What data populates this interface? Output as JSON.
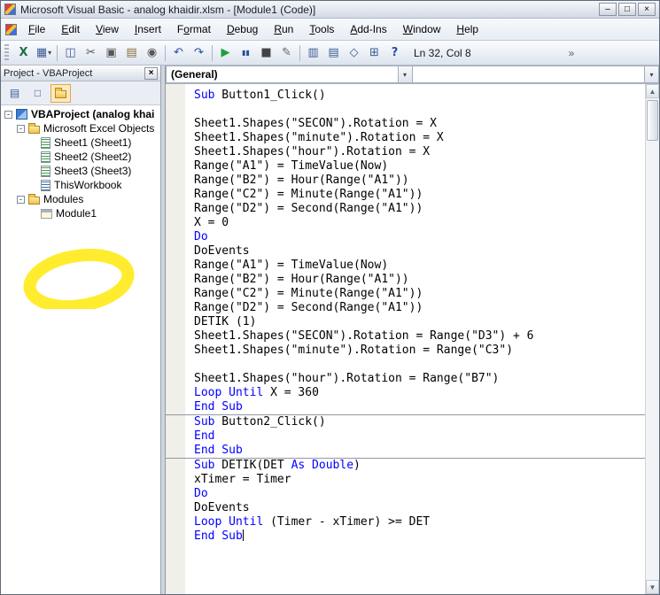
{
  "colors": {
    "keyword": "#0000ff",
    "code_text": "#000000",
    "marker": "#ffe800",
    "run_green": "#1e9e3e"
  },
  "window": {
    "title": "Microsoft Visual Basic - analog khaidir.xlsm - [Module1 (Code)]",
    "controls": [
      {
        "name": "minimize-button",
        "glyph": "–"
      },
      {
        "name": "maximize-button",
        "glyph": "□"
      },
      {
        "name": "close-button",
        "glyph": "×"
      }
    ]
  },
  "menu_bar": {
    "items": [
      {
        "label": "File",
        "accel": 0
      },
      {
        "label": "Edit",
        "accel": 0
      },
      {
        "label": "View",
        "accel": 0
      },
      {
        "label": "Insert",
        "accel": 0
      },
      {
        "label": "Format",
        "accel": 1
      },
      {
        "label": "Debug",
        "accel": 0
      },
      {
        "label": "Run",
        "accel": 0
      },
      {
        "label": "Tools",
        "accel": 0
      },
      {
        "label": "Add-Ins",
        "accel": 0
      },
      {
        "label": "Window",
        "accel": 0
      },
      {
        "label": "Help",
        "accel": 0
      }
    ]
  },
  "toolbar": {
    "position_indicator": "Ln 32, Col 8",
    "overflow_glyph": "»",
    "buttons": [
      {
        "name": "view-microsoft-excel-button",
        "glyph": "X",
        "color": "#1d7044",
        "bold": true
      },
      {
        "name": "insert-userform-button",
        "glyph": "▦",
        "color": "#3c5a96",
        "dropdown": true
      },
      {
        "sep": true
      },
      {
        "name": "save-button",
        "glyph": "◫",
        "color": "#3c5a96"
      },
      {
        "name": "cut-button",
        "glyph": "✂",
        "color": "#555555"
      },
      {
        "name": "copy-button",
        "glyph": "▣",
        "color": "#555555"
      },
      {
        "name": "paste-button",
        "glyph": "▤",
        "color": "#8a6d3b"
      },
      {
        "name": "find-button",
        "glyph": "◉",
        "color": "#555555"
      },
      {
        "sep": true
      },
      {
        "name": "undo-button",
        "glyph": "↶",
        "color": "#2b4fa0"
      },
      {
        "name": "redo-button",
        "glyph": "↷",
        "color": "#2b4fa0"
      },
      {
        "sep": true
      },
      {
        "name": "run-button",
        "glyph": "▶",
        "color": "#1e9e3e"
      },
      {
        "name": "break-button",
        "glyph": "▮▮",
        "color": "#2b4fa0",
        "small": true
      },
      {
        "name": "reset-button",
        "glyph": "■",
        "color": "#444444"
      },
      {
        "name": "design-mode-button",
        "glyph": "✎",
        "color": "#666666"
      },
      {
        "sep": true
      },
      {
        "name": "project-explorer-button",
        "glyph": "▥",
        "color": "#3c5a96"
      },
      {
        "name": "properties-window-button",
        "glyph": "▤",
        "color": "#3c5a96"
      },
      {
        "name": "object-browser-button",
        "glyph": "◇",
        "color": "#3c5a96"
      },
      {
        "name": "toolbox-button",
        "glyph": "⊞",
        "color": "#3c5a96"
      },
      {
        "name": "help-button",
        "glyph": "?",
        "color": "#2b4fa0",
        "bold": true
      }
    ]
  },
  "project_panel": {
    "title": "Project - VBAProject",
    "close_glyph": "×",
    "buttons": [
      {
        "name": "view-code-button",
        "glyph": "▤"
      },
      {
        "name": "view-object-button",
        "glyph": "□"
      },
      {
        "name": "toggle-folders-button",
        "icon": "folder",
        "pressed": true
      }
    ],
    "tree": [
      {
        "id": "vbaproject",
        "label": "VBAProject (analog khai",
        "icon": "project",
        "depth": 0,
        "expander": "-",
        "bold": true
      },
      {
        "id": "excel-objects",
        "label": "Microsoft Excel Objects",
        "icon": "folder",
        "depth": 1,
        "expander": "-"
      },
      {
        "id": "sheet1",
        "label": "Sheet1 (Sheet1)",
        "icon": "sheet",
        "depth": 2
      },
      {
        "id": "sheet2",
        "label": "Sheet2 (Sheet2)",
        "icon": "sheet",
        "depth": 2
      },
      {
        "id": "sheet3",
        "label": "Sheet3 (Sheet3)",
        "icon": "sheet",
        "depth": 2
      },
      {
        "id": "thisworkbook",
        "label": "ThisWorkbook",
        "icon": "workbook",
        "depth": 2
      },
      {
        "id": "modules",
        "label": "Modules",
        "icon": "folder",
        "depth": 1,
        "expander": "-"
      },
      {
        "id": "module1",
        "label": "Module1",
        "icon": "module",
        "depth": 2,
        "highlighted": true
      }
    ]
  },
  "code_window": {
    "object_combo": "(General)",
    "procedure_combo": "",
    "lines": [
      {
        "s": [
          [
            "b",
            "Sub"
          ],
          [
            "k",
            " Button1_Click()"
          ]
        ]
      },
      {
        "s": []
      },
      {
        "s": [
          [
            "k",
            "Sheet1.Shapes(\"SECON\").Rotation = X"
          ]
        ]
      },
      {
        "s": [
          [
            "k",
            "Sheet1.Shapes(\"minute\").Rotation = X"
          ]
        ]
      },
      {
        "s": [
          [
            "k",
            "Sheet1.Shapes(\"hour\").Rotation = X"
          ]
        ]
      },
      {
        "s": [
          [
            "k",
            "Range(\"A1\") = TimeValue(Now)"
          ]
        ]
      },
      {
        "s": [
          [
            "k",
            "Range(\"B2\") = Hour(Range(\"A1\"))"
          ]
        ]
      },
      {
        "s": [
          [
            "k",
            "Range(\"C2\") = Minute(Range(\"A1\"))"
          ]
        ]
      },
      {
        "s": [
          [
            "k",
            "Range(\"D2\") = Second(Range(\"A1\"))"
          ]
        ]
      },
      {
        "s": [
          [
            "k",
            "X = 0"
          ]
        ]
      },
      {
        "s": [
          [
            "b",
            "Do"
          ]
        ]
      },
      {
        "s": [
          [
            "k",
            "DoEvents"
          ]
        ]
      },
      {
        "s": [
          [
            "k",
            "Range(\"A1\") = TimeValue(Now)"
          ]
        ]
      },
      {
        "s": [
          [
            "k",
            "Range(\"B2\") = Hour(Range(\"A1\"))"
          ]
        ]
      },
      {
        "s": [
          [
            "k",
            "Range(\"C2\") = Minute(Range(\"A1\"))"
          ]
        ]
      },
      {
        "s": [
          [
            "k",
            "Range(\"D2\") = Second(Range(\"A1\"))"
          ]
        ]
      },
      {
        "s": [
          [
            "k",
            "DETIK (1)"
          ]
        ]
      },
      {
        "s": [
          [
            "k",
            "Sheet1.Shapes(\"SECON\").Rotation = Range(\"D3\") + 6"
          ]
        ]
      },
      {
        "s": [
          [
            "k",
            "Sheet1.Shapes(\"minute\").Rotation = Range(\"C3\")"
          ]
        ]
      },
      {
        "s": []
      },
      {
        "s": [
          [
            "k",
            "Sheet1.Shapes(\"hour\").Rotation = Range(\"B7\")"
          ]
        ]
      },
      {
        "s": [
          [
            "b",
            "Loop Until"
          ],
          [
            "k",
            " X = 360"
          ]
        ]
      },
      {
        "s": [
          [
            "b",
            "End Sub"
          ]
        ]
      },
      {
        "sep": true,
        "s": [
          [
            "b",
            "Sub"
          ],
          [
            "k",
            " Button2_Click()"
          ]
        ]
      },
      {
        "s": [
          [
            "b",
            "End"
          ]
        ]
      },
      {
        "s": [
          [
            "b",
            "End Sub"
          ]
        ]
      },
      {
        "sep": true,
        "s": [
          [
            "b",
            "Sub"
          ],
          [
            "k",
            " DETIK(DET "
          ],
          [
            "b",
            "As Double"
          ],
          [
            "k",
            ")"
          ]
        ]
      },
      {
        "s": [
          [
            "k",
            "xTimer = Timer"
          ]
        ]
      },
      {
        "s": [
          [
            "b",
            "Do"
          ]
        ]
      },
      {
        "s": [
          [
            "k",
            "DoEvents"
          ]
        ]
      },
      {
        "s": [
          [
            "b",
            "Loop Until"
          ],
          [
            "k",
            " (Timer - xTimer) >= DET"
          ]
        ]
      },
      {
        "s": [
          [
            "b",
            "End Sub"
          ]
        ],
        "caret": true
      }
    ]
  }
}
